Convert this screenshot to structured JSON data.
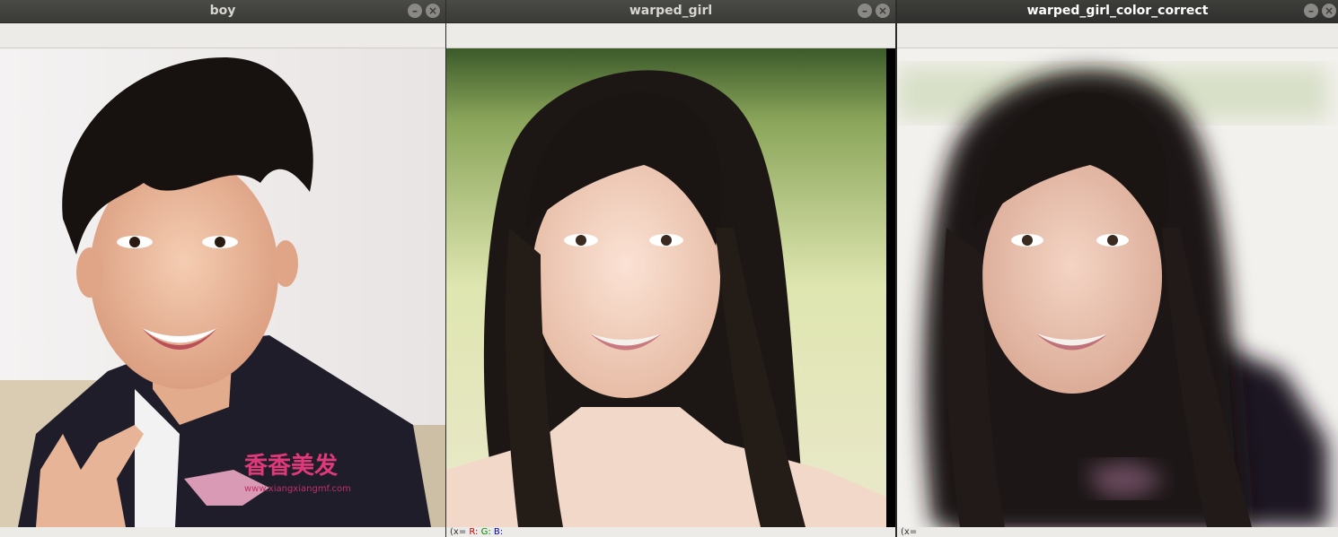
{
  "windows": [
    {
      "title": "boy",
      "minimize_icon": "minimize-icon",
      "close_icon": "close-icon",
      "watermark_logo": "香香美发",
      "watermark_url": "www.xiangxiangmf.com",
      "status": ""
    },
    {
      "title": "warped_girl",
      "minimize_icon": "minimize-icon",
      "close_icon": "close-icon",
      "status_prefix": "(x=",
      "status_r": "R:",
      "status_g": "G:",
      "status_b": "B:"
    },
    {
      "title": "warped_girl_color_correct",
      "minimize_icon": "minimize-icon",
      "close_icon": "close-icon",
      "status": "(x="
    }
  ],
  "glyphs": {
    "minimize": "–",
    "close": "×"
  },
  "colors": {
    "titlebar": "#3a3a37",
    "window_bg": "#f0eeeb"
  }
}
